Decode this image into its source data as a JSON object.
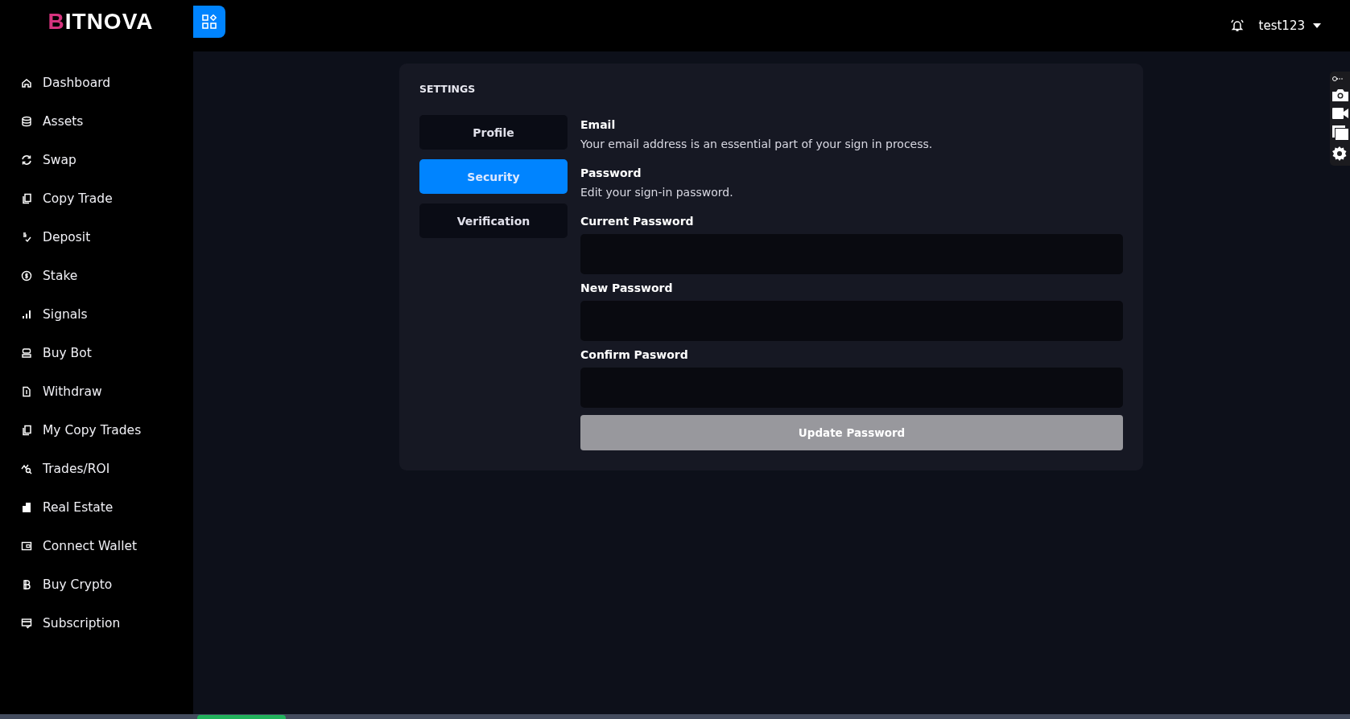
{
  "header": {
    "logo": "BITNOVA",
    "user": "test123"
  },
  "sidebar": {
    "items": [
      {
        "label": "Dashboard"
      },
      {
        "label": "Assets"
      },
      {
        "label": "Swap"
      },
      {
        "label": "Copy Trade"
      },
      {
        "label": "Deposit"
      },
      {
        "label": "Stake"
      },
      {
        "label": "Signals"
      },
      {
        "label": "Buy Bot"
      },
      {
        "label": "Withdraw"
      },
      {
        "label": "My Copy Trades"
      },
      {
        "label": "Trades/ROI"
      },
      {
        "label": "Real Estate"
      },
      {
        "label": "Connect Wallet"
      },
      {
        "label": "Buy Crypto"
      },
      {
        "label": "Subscription"
      }
    ]
  },
  "settings": {
    "title": "SETTINGS",
    "tabs": [
      {
        "label": "Profile",
        "selected": false
      },
      {
        "label": "Security",
        "selected": true
      },
      {
        "label": "Verification",
        "selected": false
      }
    ],
    "sections": [
      {
        "heading": "Email",
        "text": "Your email address is an essential part of your sign in process."
      },
      {
        "heading": "Password",
        "text": "Edit your sign-in password."
      }
    ],
    "fields": [
      {
        "label": "Current Password"
      },
      {
        "label": "New Password"
      },
      {
        "label": "Confirm Pasword"
      }
    ],
    "submit": {
      "label": "Update Password",
      "disabled": true
    }
  }
}
